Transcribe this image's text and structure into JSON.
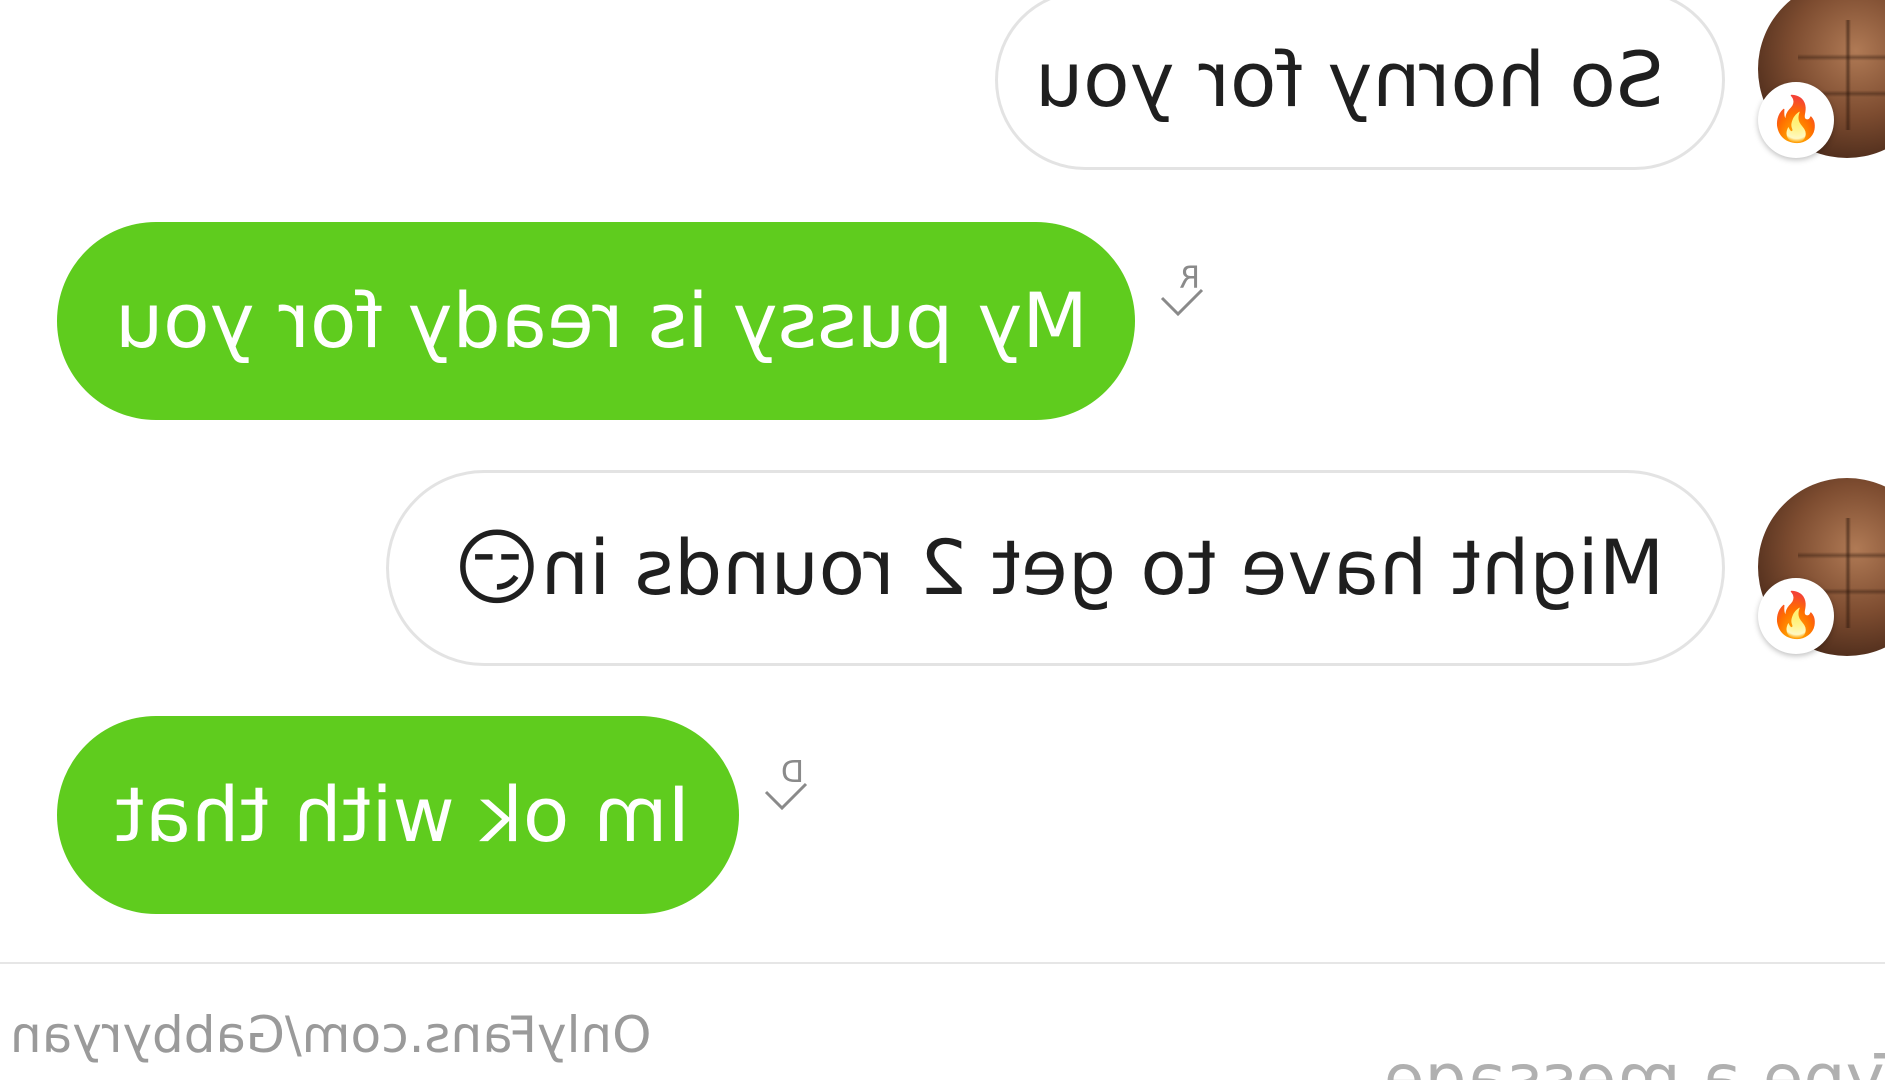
{
  "conversation": {
    "messages": [
      {
        "id": "m1",
        "direction": "incoming",
        "text": "So horny for you",
        "emoji": ""
      },
      {
        "id": "m2",
        "direction": "outgoing",
        "text": "My pussy is ready for you",
        "emoji": ""
      },
      {
        "id": "m3",
        "direction": "incoming",
        "text": "Might have to get 2 rounds in",
        "emoji": "😏"
      },
      {
        "id": "m4",
        "direction": "outgoing",
        "text": "Im ok with that",
        "emoji": ""
      }
    ]
  },
  "avatar": {
    "badge_icon": "fire-icon",
    "badge_glyph": "🔥"
  },
  "read_receipt": {
    "icon": "read-receipt-icon"
  },
  "footer": {
    "watermark": "OnlyFans.com/Gabbyryan",
    "composer_placeholder": "Type a message"
  },
  "colors": {
    "outgoing_bubble": "#5fcc1e",
    "incoming_bubble": "#ffffff",
    "incoming_border": "#e3e3e3"
  }
}
